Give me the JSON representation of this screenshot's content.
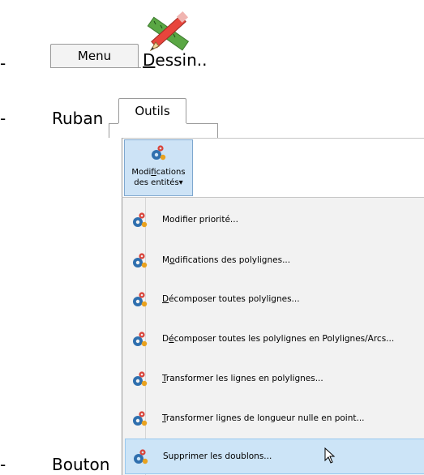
{
  "bullets": {
    "dash": "-"
  },
  "tabs": {
    "menu": "Menu",
    "dessin_prefix": "D",
    "dessin_rest": "essin..",
    "outils": "Outils"
  },
  "labels": {
    "ruban": "Ruban",
    "bouton": "Bouton"
  },
  "ribbon_button": {
    "line1_pre": "Modi",
    "line1_u": "f",
    "line1_post": "ications",
    "line2": "des entités",
    "arrow": "▾"
  },
  "menu_items": [
    {
      "pre": "",
      "u": "",
      "post": "Modifier priorité..."
    },
    {
      "pre": "M",
      "u": "o",
      "post": "difications des polylignes..."
    },
    {
      "pre": "",
      "u": "D",
      "post": "écomposer toutes polylignes..."
    },
    {
      "pre": "D",
      "u": "é",
      "post": "composer toutes les polylignes en Polylignes/Arcs..."
    },
    {
      "pre": "",
      "u": "T",
      "post": "ransformer les lignes en polylignes..."
    },
    {
      "pre": "",
      "u": "T",
      "post": "ransformer lignes de longueur nulle en point..."
    },
    {
      "pre": "",
      "u": "",
      "post": "Supprimer les doublons..."
    }
  ],
  "colors": {
    "highlight": "#cce4f7",
    "ribbon_active": "#cde3f6"
  }
}
